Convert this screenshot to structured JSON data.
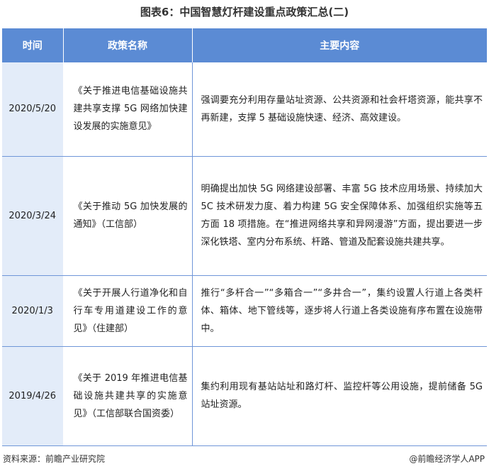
{
  "title": "图表6：中国智慧灯杆建设重点政策汇总(二)",
  "table": {
    "headers": [
      "时间",
      "政策名称",
      "主要内容"
    ],
    "rows": [
      {
        "date": "2020/5/20",
        "name": "《关于推进电信基础设施共建共享支撑 5G 网络加快建设发展的实施意见》",
        "content": "强调要充分利用存量站址资源、公共资源和社会杆塔资源，能共享不再新建，支撑 5 基础设施快速、经济、高效建设。"
      },
      {
        "date": "2020/3/24",
        "name": "《关于推动 5G 加快发展的通知》（工信部）",
        "content": "明确提出加快 5G 网络建设部署、丰富 5G 技术应用场景、持续加大 5C 技术研发力度、着力构建 5G 安全保障体系、加强组织实施等五方面 18 项措施。在“推进网络共享和异网漫游”方面，提出要进一步深化铁塔、室内分布系统、杆路、管道及配套设施共建共享。"
      },
      {
        "date": "2020/1/3",
        "name": "《关于开展人行道净化和自行车专用道建设工作的意见》（住建部）",
        "content": "推行“多杆合一”“多箱合一”“多井合一”，集约设置人行道上各类杆体、箱体、地下管线等，逐步将人行道上各类设施有序布置在设施带中。"
      },
      {
        "date": "2019/4/26",
        "name": "《关于 2019 年推进电信基础设施共建共享的实施意见》（工信部联合国资委）",
        "content": "集约利用现有基站站址和路灯杆、监控杆等公用设施，提前储备 5G 站址资源。"
      }
    ]
  },
  "footer": {
    "source": "资料来源：前瞻产业研究院",
    "brand": "@前瞻经济学人APP"
  }
}
